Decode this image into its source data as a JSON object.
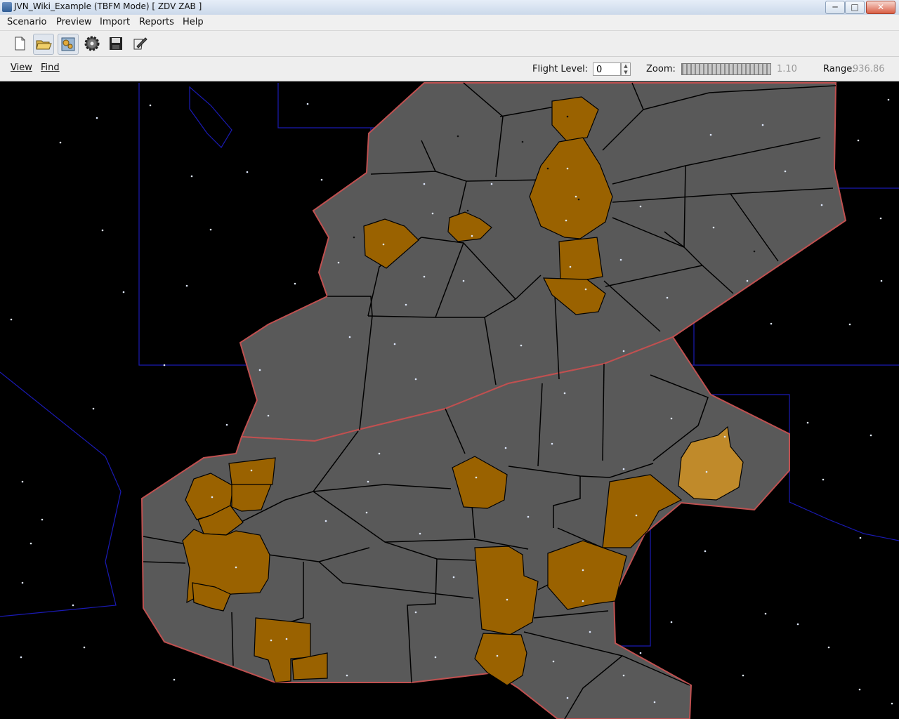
{
  "window": {
    "title": "JVN_Wiki_Example (TBFM Mode) [ ZDV ZAB ]",
    "minimize_glyph": "─",
    "maximize_glyph": "□",
    "close_glyph": "✕"
  },
  "menubar": {
    "items": [
      "Scenario",
      "Preview",
      "Import",
      "Reports",
      "Help"
    ]
  },
  "toolbar": {
    "icons": [
      "new-document-icon",
      "open-folder-icon",
      "configure-icon",
      "settings-gear-icon",
      "save-disk-icon",
      "edit-icon"
    ]
  },
  "controlbar": {
    "view_label": "View",
    "find_label": "Find",
    "flight_level_label": "Flight Level:",
    "flight_level_value": "0",
    "zoom_label": "Zoom:",
    "zoom_value": "1.10",
    "range_label": "Range:",
    "range_value": "936.86"
  },
  "colors": {
    "sector_fill": "#595959",
    "sector_outline": "#000000",
    "facility_boundary": "#c05050",
    "airport_fill": "#9a6200",
    "airport_highlight_fill": "#c08a2a",
    "state_border": "#1a1ab4",
    "background": "#000000"
  }
}
